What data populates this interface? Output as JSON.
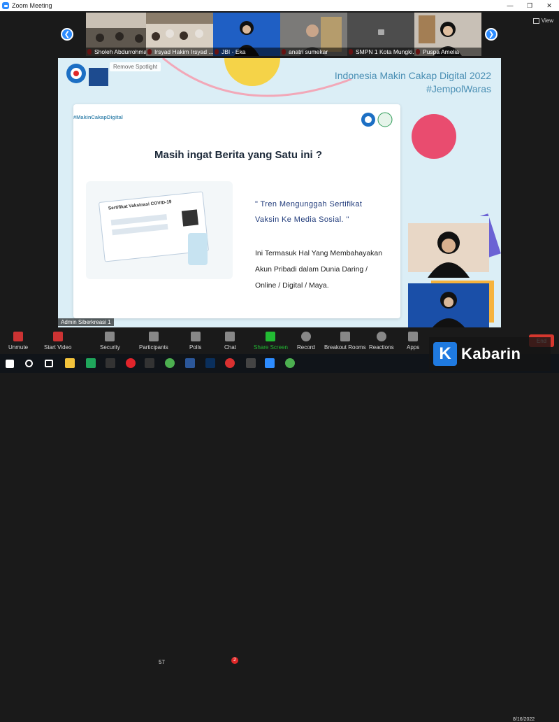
{
  "window": {
    "title": "Zoom Meeting"
  },
  "view_label": "View",
  "participants": [
    {
      "name": "Sholeh Abdurrohman",
      "muted": true
    },
    {
      "name": "Irsyad Hakim Irsyad ...",
      "muted": true
    },
    {
      "name": "JBI - Eka",
      "muted": true
    },
    {
      "name": "anatri sumekar",
      "muted": true
    },
    {
      "name": "SMPN 1 Kota Mungki...",
      "muted": true
    },
    {
      "name": "Puspa Amelia",
      "muted": true
    }
  ],
  "share": {
    "spotlight_label": "Remove Spotlight",
    "event_title": "Indonesia Makin Cakap Digital 2022",
    "event_hashtag": "#JempolWaras",
    "slide": {
      "hashtag": "#MakinCakapDigital",
      "title": "Masih ingat Berita yang Satu ini ?",
      "quote_line1": "\" Tren Mengunggah Sertifikat",
      "quote_line2": "Vaksin Ke Media Sosial. \"",
      "body_line1": "Ini Termasuk Hal Yang Membahayakan",
      "body_line2": "Akun Pribadi dalam Dunia Daring /",
      "body_line3": "Online / Digital / Maya.",
      "certificate_title": "Sertifikat Vaksinasi COVID-19"
    },
    "active_speaker": "Admin Siberkreasi 1"
  },
  "toolbar": {
    "unmute": "Unmute",
    "start_video": "Start Video",
    "security": "Security",
    "participants": "Participants",
    "participants_count": "57",
    "polls": "Polls",
    "chat": "Chat",
    "chat_badge": "2",
    "share_screen": "Share Screen",
    "record": "Record",
    "breakout": "Breakout Rooms",
    "reactions": "Reactions",
    "apps": "Apps",
    "end": "End"
  },
  "watermark": {
    "brand": "Kabarin"
  },
  "taskbar": {
    "date": "8/16/2022"
  },
  "colors": {
    "accent": "#2d8cff",
    "share_green": "#22bb33",
    "end_red": "#d6372e"
  }
}
